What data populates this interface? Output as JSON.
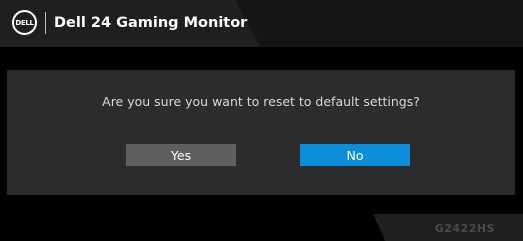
{
  "header": {
    "logo_text": "DELL",
    "title": "Dell 24 Gaming Monitor"
  },
  "dialog": {
    "question": "Are you sure you want to reset to default settings?",
    "yes_label": "Yes",
    "no_label": "No",
    "selected": "No"
  },
  "footer": {
    "model": "G2422HS"
  },
  "colors": {
    "background": "#000000",
    "header": "#1f1f1f",
    "dialog": "#2c2c2c",
    "button_default": "#5f5f5f",
    "button_selected": "#0c8fdb",
    "model_text": "#4a4a4a"
  }
}
